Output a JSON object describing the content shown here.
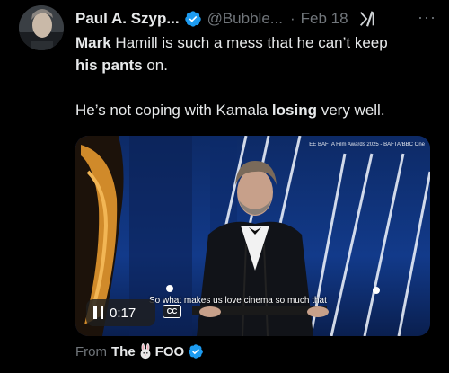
{
  "tweet": {
    "author_name": "Paul A. Szyp...",
    "handle": "@Bubble...",
    "separator": "·",
    "date": "Feb 18",
    "more_label": "···",
    "body_line1_bold_a": "Mark",
    "body_line1_rest": " Hamill is such a mess that he can’t keep",
    "body_line2_bold": "his pants",
    "body_line2_rest": " on.",
    "body_p2_pre": "He’s not coping with Kamala ",
    "body_p2_bold": "losing",
    "body_p2_post": " very well."
  },
  "video": {
    "watermark": "EE BAFTA Film Awards 2025 - BAFTA/BBC One",
    "subtitle": "So what makes us love cinema so much that",
    "time": "0:17",
    "cc_label": "CC"
  },
  "footer": {
    "from_label": "From",
    "source_pre": "The",
    "source_post": "FOO"
  },
  "colors": {
    "background": "#000000",
    "text": "#e7e9ea",
    "secondary": "#71767b",
    "verified": "#1d9bf0"
  },
  "icons": [
    "verified-badge-icon",
    "grok-icon",
    "more-icon",
    "pause-icon",
    "cc-icon",
    "rabbit-emoji-icon"
  ]
}
